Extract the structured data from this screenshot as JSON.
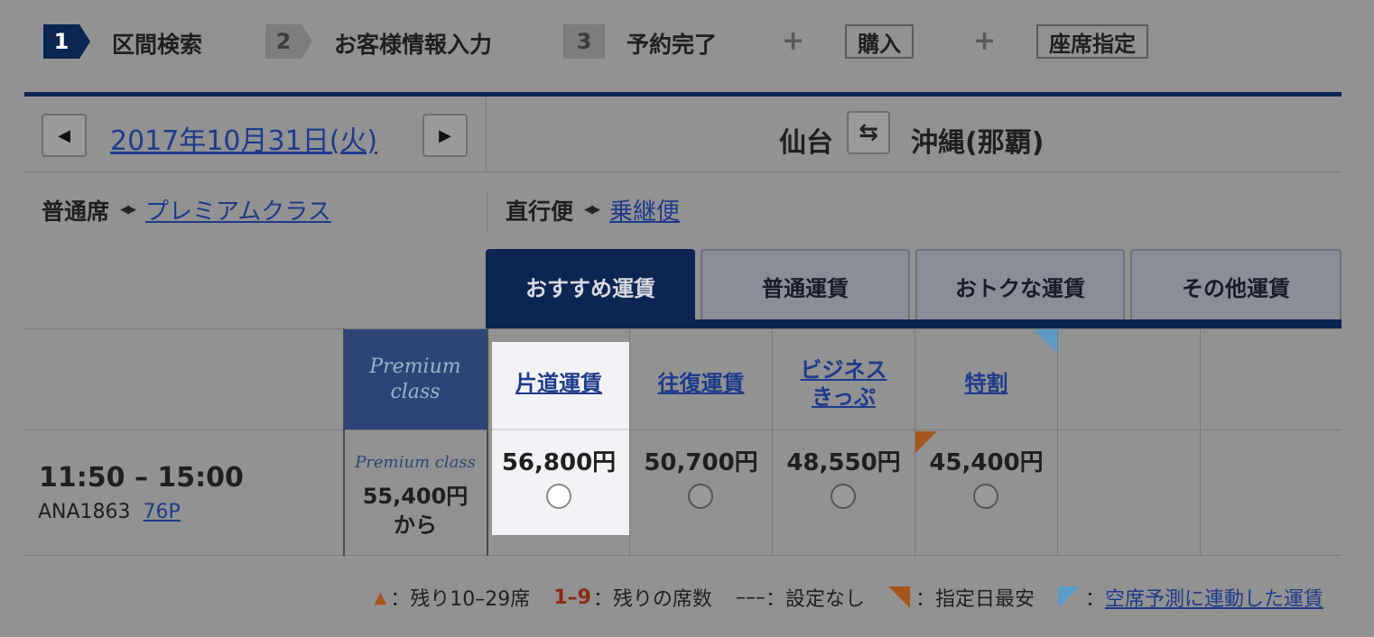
{
  "steps": [
    {
      "num": "1",
      "label": "区間検索"
    },
    {
      "num": "2",
      "label": "お客様情報入力"
    },
    {
      "num": "3",
      "label": "予約完了"
    }
  ],
  "plus_sign": "+",
  "optional_steps": [
    "購入",
    "座席指定"
  ],
  "date": {
    "label": "2017年10月31日(火)",
    "prev_icon": "◀",
    "next_icon": "▶"
  },
  "route": {
    "from": "仙台",
    "to": "沖縄(那覇)",
    "swap_icon": "⇆"
  },
  "seat_class": {
    "current": "普通席",
    "switch_icon": "◀▶",
    "alternate": "プレミアムクラス"
  },
  "flight_type": {
    "current": "直行便",
    "switch_icon": "◀▶",
    "alternate": "乗継便"
  },
  "tabs": [
    "おすすめ運賃",
    "普通運賃",
    "おトクな運賃",
    "その他運賃"
  ],
  "premium_header": {
    "line1": "Premium",
    "line2": "class"
  },
  "fare_columns": [
    {
      "label_lines": [
        "片道運賃"
      ],
      "price": "56,800円",
      "selected": true
    },
    {
      "label_lines": [
        "往復運賃"
      ],
      "price": "50,700円",
      "selected": false
    },
    {
      "label_lines": [
        "ビジネス",
        "きっぷ"
      ],
      "price": "48,550円",
      "selected": false
    },
    {
      "label_lines": [
        "特割"
      ],
      "price": "45,400円",
      "selected": false
    }
  ],
  "flight": {
    "time": "11:50 – 15:00",
    "number": "ANA1863",
    "aircraft": "76P",
    "premium_label": "Premium class",
    "premium_price": "55,400円",
    "premium_suffix": "から"
  },
  "legend": {
    "triangle_symbol": "▲",
    "remaining_10_29": "：残り10–29席",
    "range_label": "1–9",
    "remaining_seats": "：残りの席数",
    "none_symbol": "–––",
    "none_label": "：設定なし",
    "lowest_label": "：指定日最安",
    "linked_label": "空席予測に連動した運賃",
    "colon": "："
  },
  "colors": {
    "navy": "#0d2553",
    "link": "#1d3b8a",
    "orange": "#a4561d",
    "blue_marker": "#5b9bc6"
  }
}
